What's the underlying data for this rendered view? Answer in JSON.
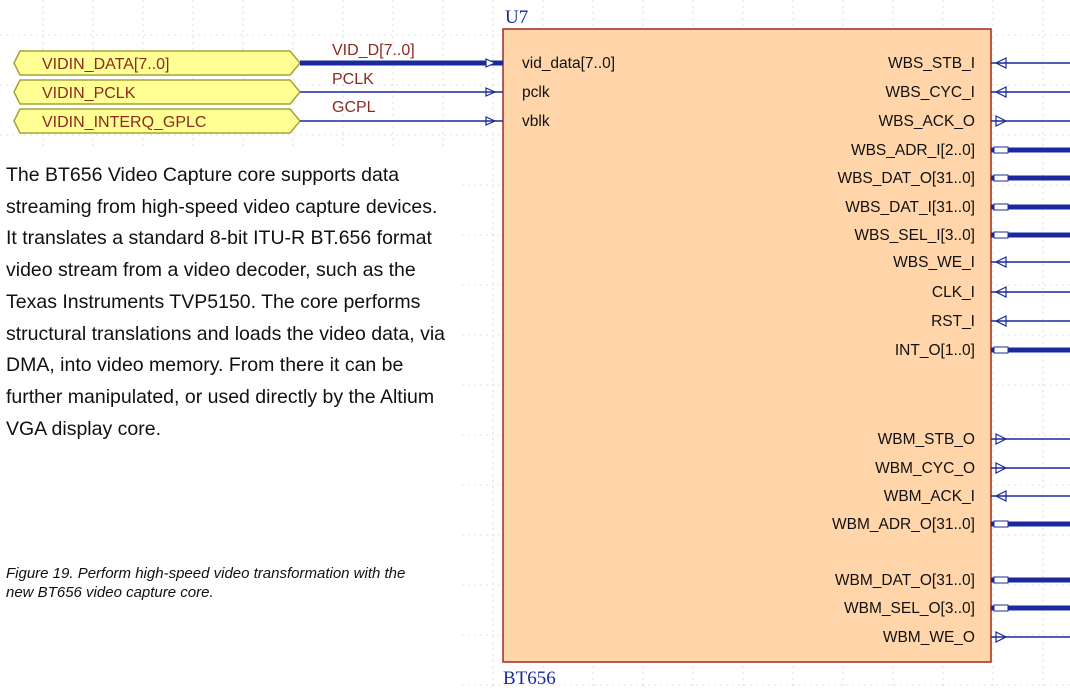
{
  "component": {
    "designator": "U7",
    "part_name": "BT656",
    "left_pins": [
      "vid_data[7..0]",
      "pclk",
      "vblk"
    ],
    "right_pins": [
      "WBS_STB_I",
      "WBS_CYC_I",
      "WBS_ACK_O",
      "WBS_ADR_I[2..0]",
      "WBS_DAT_O[31..0]",
      "WBS_DAT_I[31..0]",
      "WBS_SEL_I[3..0]",
      "WBS_WE_I",
      "CLK_I",
      "RST_I",
      "INT_O[1..0]",
      "WBM_STB_O",
      "WBM_CYC_O",
      "WBM_ACK_I",
      "WBM_ADR_O[31..0]",
      "WBM_DAT_O[31..0]",
      "WBM_SEL_O[3..0]",
      "WBM_WE_O"
    ]
  },
  "ports": [
    "VIDIN_DATA[7..0]",
    "VIDIN_PCLK",
    "VIDIN_INTERQ_GPLC"
  ],
  "nets": [
    "VID_D[7..0]",
    "PCLK",
    "GCPL"
  ],
  "description": "The BT656 Video Capture core supports data streaming from high-speed video capture devices. It translates a standard 8-bit ITU-R BT.656 format video stream from a video decoder, such as the Texas Instruments TVP5150. The core performs structural translations and loads the video data, via DMA, into video memory. From there it can be further manipulated, or used directly by the Altium VGA display core.",
  "caption": "Figure 19. Perform high-speed video transformation with the new BT656 video capture core.",
  "colors": {
    "component_fill": "#ffd5a9",
    "component_border": "#a12b21",
    "port_fill": "#ffff94",
    "port_border": "#a3a33a",
    "port_text": "#8b2a1f",
    "wire": "#1a2a9c",
    "net_label": "#8b2a1f",
    "grid": "#c8c8c8",
    "designator": "#1a2a9c"
  }
}
